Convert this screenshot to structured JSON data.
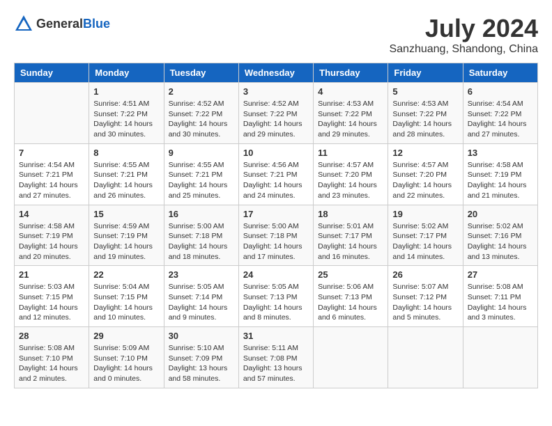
{
  "logo": {
    "text_general": "General",
    "text_blue": "Blue"
  },
  "header": {
    "month_year": "July 2024",
    "location": "Sanzhuang, Shandong, China"
  },
  "weekdays": [
    "Sunday",
    "Monday",
    "Tuesday",
    "Wednesday",
    "Thursday",
    "Friday",
    "Saturday"
  ],
  "weeks": [
    [
      {
        "day": "",
        "info": ""
      },
      {
        "day": "1",
        "info": "Sunrise: 4:51 AM\nSunset: 7:22 PM\nDaylight: 14 hours\nand 30 minutes."
      },
      {
        "day": "2",
        "info": "Sunrise: 4:52 AM\nSunset: 7:22 PM\nDaylight: 14 hours\nand 30 minutes."
      },
      {
        "day": "3",
        "info": "Sunrise: 4:52 AM\nSunset: 7:22 PM\nDaylight: 14 hours\nand 29 minutes."
      },
      {
        "day": "4",
        "info": "Sunrise: 4:53 AM\nSunset: 7:22 PM\nDaylight: 14 hours\nand 29 minutes."
      },
      {
        "day": "5",
        "info": "Sunrise: 4:53 AM\nSunset: 7:22 PM\nDaylight: 14 hours\nand 28 minutes."
      },
      {
        "day": "6",
        "info": "Sunrise: 4:54 AM\nSunset: 7:22 PM\nDaylight: 14 hours\nand 27 minutes."
      }
    ],
    [
      {
        "day": "7",
        "info": "Sunrise: 4:54 AM\nSunset: 7:21 PM\nDaylight: 14 hours\nand 27 minutes."
      },
      {
        "day": "8",
        "info": "Sunrise: 4:55 AM\nSunset: 7:21 PM\nDaylight: 14 hours\nand 26 minutes."
      },
      {
        "day": "9",
        "info": "Sunrise: 4:55 AM\nSunset: 7:21 PM\nDaylight: 14 hours\nand 25 minutes."
      },
      {
        "day": "10",
        "info": "Sunrise: 4:56 AM\nSunset: 7:21 PM\nDaylight: 14 hours\nand 24 minutes."
      },
      {
        "day": "11",
        "info": "Sunrise: 4:57 AM\nSunset: 7:20 PM\nDaylight: 14 hours\nand 23 minutes."
      },
      {
        "day": "12",
        "info": "Sunrise: 4:57 AM\nSunset: 7:20 PM\nDaylight: 14 hours\nand 22 minutes."
      },
      {
        "day": "13",
        "info": "Sunrise: 4:58 AM\nSunset: 7:19 PM\nDaylight: 14 hours\nand 21 minutes."
      }
    ],
    [
      {
        "day": "14",
        "info": "Sunrise: 4:58 AM\nSunset: 7:19 PM\nDaylight: 14 hours\nand 20 minutes."
      },
      {
        "day": "15",
        "info": "Sunrise: 4:59 AM\nSunset: 7:19 PM\nDaylight: 14 hours\nand 19 minutes."
      },
      {
        "day": "16",
        "info": "Sunrise: 5:00 AM\nSunset: 7:18 PM\nDaylight: 14 hours\nand 18 minutes."
      },
      {
        "day": "17",
        "info": "Sunrise: 5:00 AM\nSunset: 7:18 PM\nDaylight: 14 hours\nand 17 minutes."
      },
      {
        "day": "18",
        "info": "Sunrise: 5:01 AM\nSunset: 7:17 PM\nDaylight: 14 hours\nand 16 minutes."
      },
      {
        "day": "19",
        "info": "Sunrise: 5:02 AM\nSunset: 7:17 PM\nDaylight: 14 hours\nand 14 minutes."
      },
      {
        "day": "20",
        "info": "Sunrise: 5:02 AM\nSunset: 7:16 PM\nDaylight: 14 hours\nand 13 minutes."
      }
    ],
    [
      {
        "day": "21",
        "info": "Sunrise: 5:03 AM\nSunset: 7:15 PM\nDaylight: 14 hours\nand 12 minutes."
      },
      {
        "day": "22",
        "info": "Sunrise: 5:04 AM\nSunset: 7:15 PM\nDaylight: 14 hours\nand 10 minutes."
      },
      {
        "day": "23",
        "info": "Sunrise: 5:05 AM\nSunset: 7:14 PM\nDaylight: 14 hours\nand 9 minutes."
      },
      {
        "day": "24",
        "info": "Sunrise: 5:05 AM\nSunset: 7:13 PM\nDaylight: 14 hours\nand 8 minutes."
      },
      {
        "day": "25",
        "info": "Sunrise: 5:06 AM\nSunset: 7:13 PM\nDaylight: 14 hours\nand 6 minutes."
      },
      {
        "day": "26",
        "info": "Sunrise: 5:07 AM\nSunset: 7:12 PM\nDaylight: 14 hours\nand 5 minutes."
      },
      {
        "day": "27",
        "info": "Sunrise: 5:08 AM\nSunset: 7:11 PM\nDaylight: 14 hours\nand 3 minutes."
      }
    ],
    [
      {
        "day": "28",
        "info": "Sunrise: 5:08 AM\nSunset: 7:10 PM\nDaylight: 14 hours\nand 2 minutes."
      },
      {
        "day": "29",
        "info": "Sunrise: 5:09 AM\nSunset: 7:10 PM\nDaylight: 14 hours\nand 0 minutes."
      },
      {
        "day": "30",
        "info": "Sunrise: 5:10 AM\nSunset: 7:09 PM\nDaylight: 13 hours\nand 58 minutes."
      },
      {
        "day": "31",
        "info": "Sunrise: 5:11 AM\nSunset: 7:08 PM\nDaylight: 13 hours\nand 57 minutes."
      },
      {
        "day": "",
        "info": ""
      },
      {
        "day": "",
        "info": ""
      },
      {
        "day": "",
        "info": ""
      }
    ]
  ]
}
